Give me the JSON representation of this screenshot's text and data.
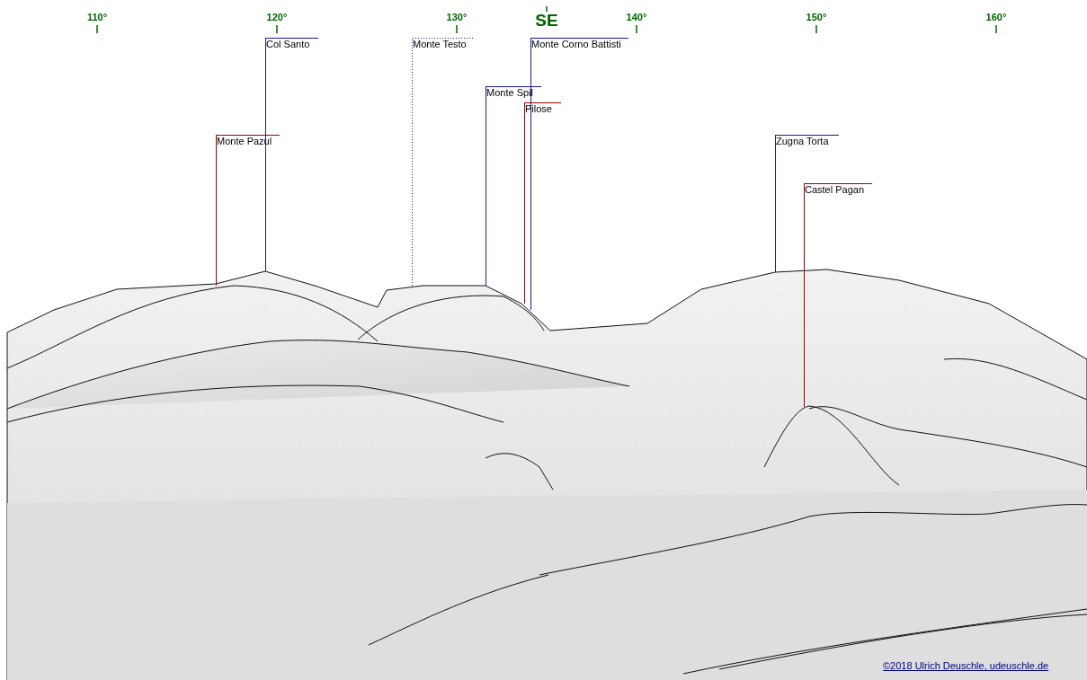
{
  "scale": [
    {
      "label": "110°",
      "kind": "degree"
    },
    {
      "label": "120°",
      "kind": "degree"
    },
    {
      "label": "130°",
      "kind": "degree"
    },
    {
      "label": "SE",
      "kind": "direction"
    },
    {
      "label": "140°",
      "kind": "degree"
    },
    {
      "label": "150°",
      "kind": "degree"
    },
    {
      "label": "160°",
      "kind": "degree"
    }
  ],
  "peaks": [
    {
      "name": "Col Santo",
      "color": "#1a1a9a",
      "kind": "solid"
    },
    {
      "name": "Monte Testo",
      "color": "#1a1a9a",
      "kind": "dotted"
    },
    {
      "name": "Monte Corno Battisti",
      "color": "#1a1a9a",
      "kind": "solid"
    },
    {
      "name": "Monte Spil",
      "color": "#1a1a9a",
      "kind": "solid"
    },
    {
      "name": "Pilose",
      "color": "#a00000",
      "kind": "solid"
    },
    {
      "name": "Monte Pazul",
      "color": "#a00000",
      "kind": "solid"
    },
    {
      "name": "Zugna Torta",
      "color": "#1a1a9a",
      "kind": "solid"
    },
    {
      "name": "Castel Pagan",
      "color": "#a00000",
      "kind": "solid"
    }
  ],
  "credit": "©2018 Ulrich Deuschle, udeuschle.de"
}
